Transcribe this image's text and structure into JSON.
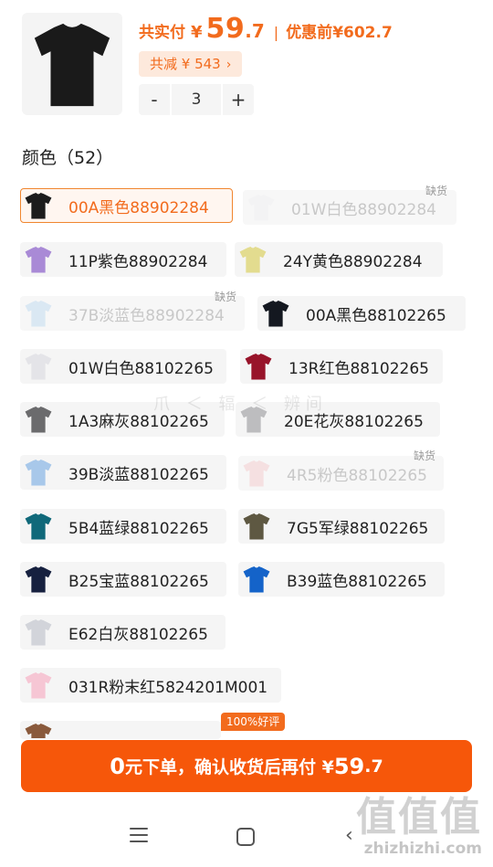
{
  "summary": {
    "total_label": "共实付",
    "currency": "¥",
    "price_int": "59",
    "price_dec": ".7",
    "separator": "|",
    "original_label": "优惠前",
    "original_price": "¥602.7",
    "discount_text": "共减 ¥ 543",
    "discount_chevron": "›",
    "product_color": "#1a1a1a"
  },
  "stepper": {
    "minus": "-",
    "quantity": "3",
    "plus": "+"
  },
  "color_section": {
    "title": "颜色（52）"
  },
  "colors": [
    {
      "label": "00A黑色88902284",
      "swatch": "#1c1c1c",
      "state": "selected"
    },
    {
      "label": "01W白色88902284",
      "swatch": "#f0f0f2",
      "state": "disabled",
      "stock": "缺货"
    },
    {
      "label": "11P紫色88902284",
      "swatch": "#a98ad6",
      "state": "normal"
    },
    {
      "label": "24Y黄色88902284",
      "swatch": "#e3dc8f",
      "state": "normal"
    },
    {
      "label": "37B淡蓝色88902284",
      "swatch": "#b9d6ef",
      "state": "disabled",
      "stock": "缺货"
    },
    {
      "label": "00A黑色88102265",
      "swatch": "#141820",
      "state": "normal"
    },
    {
      "label": "01W白色88102265",
      "swatch": "#e4e4e8",
      "state": "normal"
    },
    {
      "label": "13R红色88102265",
      "swatch": "#98142a",
      "state": "normal"
    },
    {
      "label": "1A3麻灰88102265",
      "swatch": "#6b6b6d",
      "state": "normal"
    },
    {
      "label": "20E花灰88102265",
      "swatch": "#bdbdbf",
      "state": "normal"
    },
    {
      "label": "39B淡蓝88102265",
      "swatch": "#a8c8ea",
      "state": "normal"
    },
    {
      "label": "4R5粉色88102265",
      "swatch": "#f4c6c8",
      "state": "disabled",
      "stock": "缺货"
    },
    {
      "label": "5B4蓝绿88102265",
      "swatch": "#10697a",
      "state": "normal"
    },
    {
      "label": "7G5军绿88102265",
      "swatch": "#5e5842",
      "state": "normal"
    },
    {
      "label": "B25宝蓝88102265",
      "swatch": "#16203f",
      "state": "normal"
    },
    {
      "label": "B39蓝色88102265",
      "swatch": "#1463c9",
      "state": "normal"
    },
    {
      "label": "E62白灰88102265",
      "swatch": "#d2d4da",
      "state": "normal"
    },
    {
      "label": "031R粉末红5824201M001",
      "swatch": "#f6c6d4",
      "state": "normal"
    },
    {
      "label": "",
      "swatch": "#8a5a3c",
      "state": "normal"
    }
  ],
  "badge": {
    "text": "100%好评"
  },
  "cta": {
    "part1": "0",
    "part2": "元下单，确认收货后再付 ¥",
    "part3": "59",
    "part4": ".7"
  },
  "watermark": {
    "glyphs": "值值值",
    "url": "zhizhizhi.com",
    "mid": "爪 ＜ 辐 ＜ 辨间"
  },
  "colors_theme": {
    "accent": "#f26b1d",
    "cta": "#f6570a"
  }
}
